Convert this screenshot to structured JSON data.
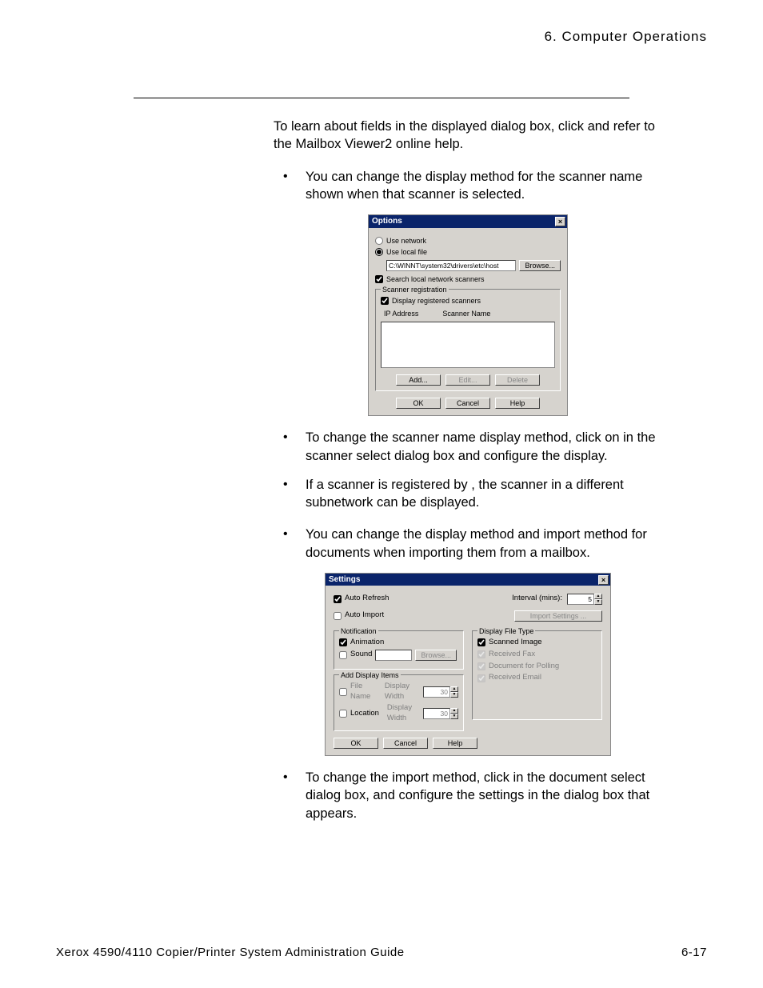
{
  "header": {
    "chapter": "6. Computer Operations"
  },
  "body": {
    "intro_a": "To learn about fields in the displayed dialog box, click ",
    "intro_b": " and refer to the Mailbox Viewer2 online help.",
    "bullet1": "You can change the display method for the scanner name shown when that scanner is selected.",
    "bullet2": "To change the scanner name display method, click on  in the scanner select dialog box and configure the display.",
    "bullet3": "If a scanner is registered by , the scanner in a different subnetwork can be displayed.",
    "bullet4": "You can change the display method and import method for documents when importing them from a mailbox.",
    "bullet5": "To change the import method, click  in the document select dialog box, and configure the settings in the dialog box that appears."
  },
  "dlg1": {
    "title": "Options",
    "use_network": "Use network",
    "use_local": "Use local file",
    "path": "C:\\WINNT\\system32\\drivers\\etc\\host",
    "browse": "Browse...",
    "search": "Search local network scanners",
    "reg_group": "Scanner registration",
    "display_reg": "Display registered scanners",
    "col_ip": "IP Address",
    "col_name": "Scanner Name",
    "add": "Add...",
    "edit": "Edit...",
    "delete": "Delete",
    "ok": "OK",
    "cancel": "Cancel",
    "help": "Help"
  },
  "dlg2": {
    "title": "Settings",
    "auto_refresh": "Auto Refresh",
    "interval_label": "Interval (mins):",
    "interval_value": "5",
    "auto_import": "Auto Import",
    "import_settings": "Import Settings ...",
    "notification": "Notification",
    "animation": "Animation",
    "sound": "Sound",
    "browse": "Browse...",
    "add_items": "Add Display Items",
    "file_name": "File Name",
    "location": "Location",
    "display_width": "Display Width",
    "width_val": "30",
    "disp_file_type": "Display File Type",
    "scanned_image": "Scanned Image",
    "received_fax": "Received Fax",
    "doc_polling": "Document for Polling",
    "received_email": "Received Email",
    "ok": "OK",
    "cancel": "Cancel",
    "help": "Help"
  },
  "footer": {
    "left": "Xerox 4590/4110 Copier/Printer System Administration Guide",
    "right": "6-17"
  }
}
